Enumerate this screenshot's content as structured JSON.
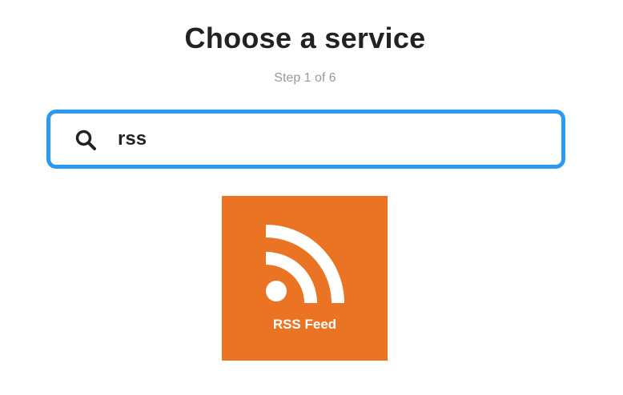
{
  "header": {
    "title": "Choose a service",
    "step": "Step 1 of 6"
  },
  "search": {
    "value": "rss",
    "icon": "search-icon",
    "border_color": "#2b9af3"
  },
  "results": [
    {
      "label": "RSS Feed",
      "icon": "rss-icon",
      "color": "#ea7423"
    }
  ]
}
